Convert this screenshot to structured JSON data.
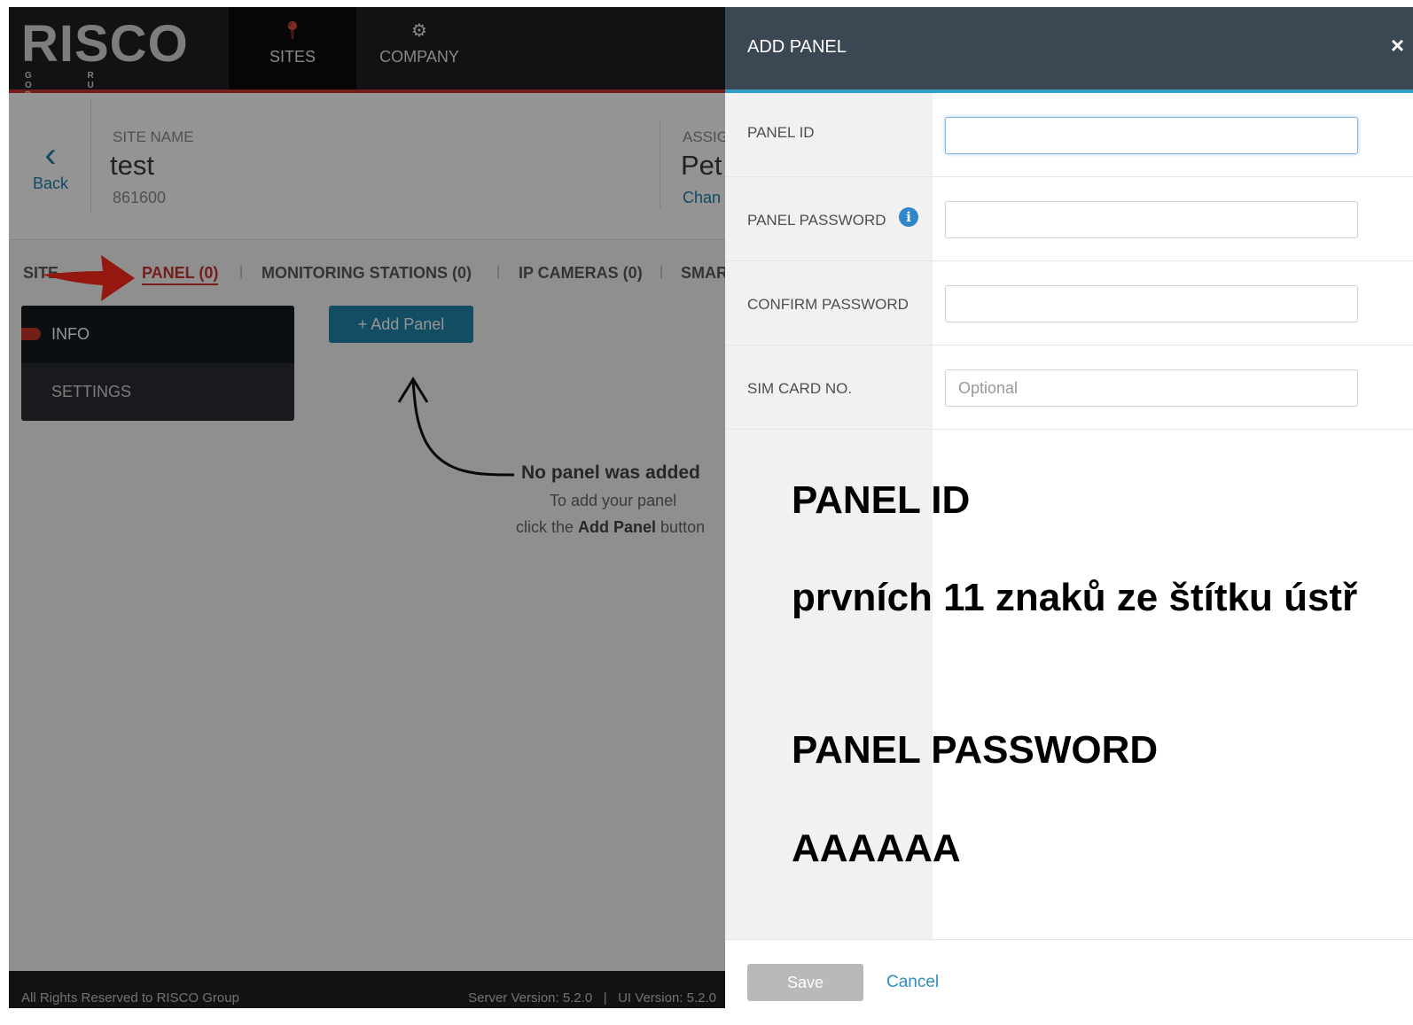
{
  "app": {
    "logo": {
      "word": "RISCO",
      "sub": "G R O U P"
    },
    "nav": [
      {
        "label": "SITES",
        "icon": "map-pin-icon"
      },
      {
        "label": "COMPANY",
        "icon": "gear-icon"
      }
    ],
    "site": {
      "back_label": "Back",
      "name_label": "SITE NAME",
      "name_value": "test",
      "site_id": "861600",
      "assigned_label": "ASSIG",
      "assigned_value": "Pet",
      "change_link": "Chan"
    },
    "tabs": [
      {
        "label": "SITE"
      },
      {
        "label": "PANEL (0)",
        "active": true
      },
      {
        "label": "MONITORING STATIONS (0)"
      },
      {
        "label": "IP CAMERAS (0)"
      },
      {
        "label": "SMAR"
      }
    ],
    "tab_separator": "|",
    "side_menu": [
      {
        "label": "INFO",
        "active": true
      },
      {
        "label": "SETTINGS"
      }
    ],
    "add_panel_button": "+ Add Panel",
    "empty_state": {
      "title": "No panel was added",
      "line1": "To add your panel",
      "line2_prefix": "click the ",
      "line2_bold": "Add Panel",
      "line2_suffix": " button"
    },
    "footer": {
      "rights": "All Rights Reserved to RISCO Group",
      "version": "Server Version: 5.2.0   |   UI Version: 5.2.0"
    }
  },
  "modal": {
    "title": "ADD PANEL",
    "close_symbol": "×",
    "fields": {
      "panel_id": {
        "label": "PANEL ID",
        "value": "",
        "placeholder": ""
      },
      "panel_password": {
        "label": "PANEL PASSWORD",
        "value": "",
        "placeholder": "",
        "info_icon": "info-icon"
      },
      "confirm_password": {
        "label": "CONFIRM PASSWORD",
        "value": "",
        "placeholder": ""
      },
      "sim_card": {
        "label": "SIM CARD NO.",
        "value": "",
        "placeholder": "Optional"
      }
    },
    "annotations": [
      "PANEL ID",
      "prvních 11 znaků ze štítku ústř",
      "PANEL PASSWORD",
      "AAAAAA"
    ],
    "save_label": "Save",
    "cancel_label": "Cancel"
  },
  "colors": {
    "brand_red": "#c9342b",
    "accent_blue": "#1f86ad",
    "modal_header": "#3c4754",
    "link_blue": "#2f8dc2"
  }
}
